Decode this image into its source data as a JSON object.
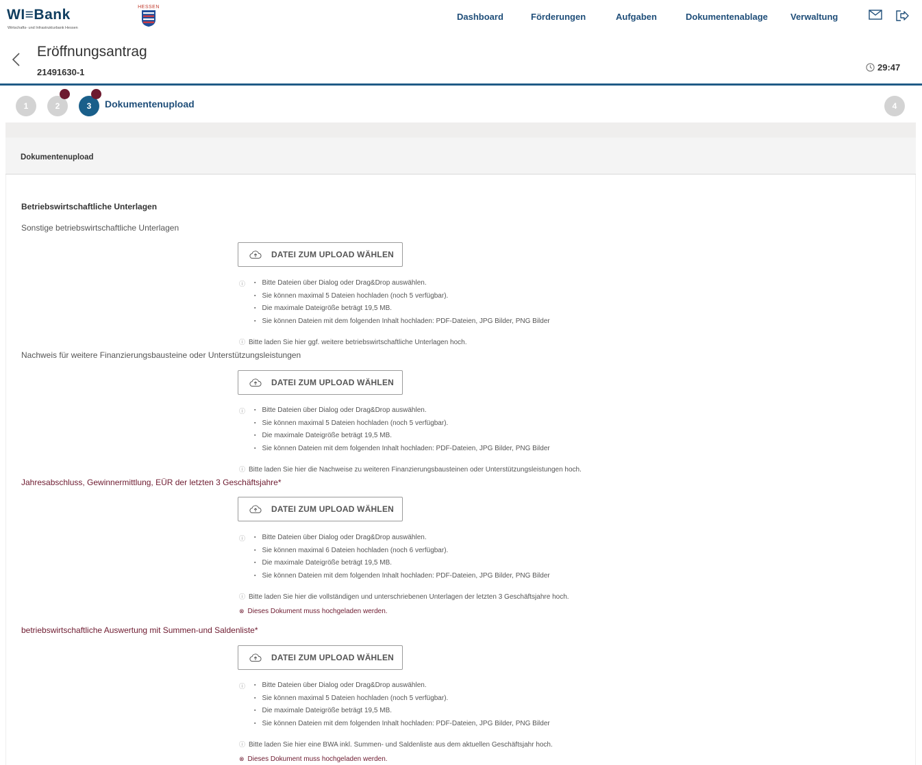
{
  "header": {
    "logo_text": "WI≡Bank",
    "logo_subtitle": "Wirtschafts- und Infrastrukturbank Hessen",
    "state_label": "HESSEN",
    "nav": [
      "Dashboard",
      "Förderungen",
      "Aufgaben",
      "Dokumentenablage",
      "Verwaltung"
    ],
    "icons": [
      "mail-icon",
      "logout-icon"
    ]
  },
  "titlebar": {
    "title": "Eröffnungsantrag",
    "number": "21491630-1",
    "timer": "29:47"
  },
  "stepper": {
    "steps": [
      "1",
      "2",
      "3",
      "4"
    ],
    "active_label": "Dokumentenupload"
  },
  "section": {
    "header": "Dokumentenupload",
    "subheader": "Betriebswirtschaftliche Unterlagen",
    "upload_label": "DATEI ZUM UPLOAD WÄHLEN",
    "error_text": "Dieses Dokument muss hochgeladen werden.",
    "items": [
      {
        "label": "Sonstige betriebswirtschaftliche Unterlagen",
        "rules": [
          "Bitte Dateien über Dialog oder Drag&Drop auswählen.",
          "Sie können maximal 5 Dateien hochladen (noch 5 verfügbar).",
          "Die maximale Dateigröße beträgt 19,5 MB.",
          "Sie können Dateien mit dem folgenden Inhalt hochladen: PDF-Dateien, JPG Bilder, PNG Bilder"
        ],
        "hint": "Bitte laden Sie hier ggf. weitere betriebswirtschaftliche Unterlagen hoch."
      },
      {
        "label": "Nachweis für weitere Finanzierungsbausteine oder Unterstützungsleistungen",
        "rules": [
          "Bitte Dateien über Dialog oder Drag&Drop auswählen.",
          "Sie können maximal 5 Dateien hochladen (noch 5 verfügbar).",
          "Die maximale Dateigröße beträgt 19,5 MB.",
          "Sie können Dateien mit dem folgenden Inhalt hochladen: PDF-Dateien, JPG Bilder, PNG Bilder"
        ],
        "hint": "Bitte laden Sie hier die Nachweise zu weiteren Finanzierungsbausteinen oder Unterstützungsleistungen hoch."
      },
      {
        "label": "Jahresabschluss, Gewinnermittlung, EÜR der letzten 3 Geschäftsjahre*",
        "rules": [
          "Bitte Dateien über Dialog oder Drag&Drop auswählen.",
          "Sie können maximal 6 Dateien hochladen (noch 6 verfügbar).",
          "Die maximale Dateigröße beträgt 19,5 MB.",
          "Sie können Dateien mit dem folgenden Inhalt hochladen: PDF-Dateien, JPG Bilder, PNG Bilder"
        ],
        "hint": "Bitte laden Sie hier die vollständigen und unterschriebenen Unterlagen der letzten 3 Geschäftsjahre hoch."
      },
      {
        "label": "betriebswirtschaftliche Auswertung mit Summen-und Saldenliste*",
        "rules": [
          "Bitte Dateien über Dialog oder Drag&Drop auswählen.",
          "Sie können maximal 5 Dateien hochladen (noch 5 verfügbar).",
          "Die maximale Dateigröße beträgt 19,5 MB.",
          "Sie können Dateien mit dem folgenden Inhalt hochladen: PDF-Dateien, JPG Bilder, PNG Bilder"
        ],
        "hint": "Bitte laden Sie hier eine BWA inkl. Summen- und Saldenliste aus dem aktuellen Geschäftsjahr hoch."
      }
    ]
  }
}
